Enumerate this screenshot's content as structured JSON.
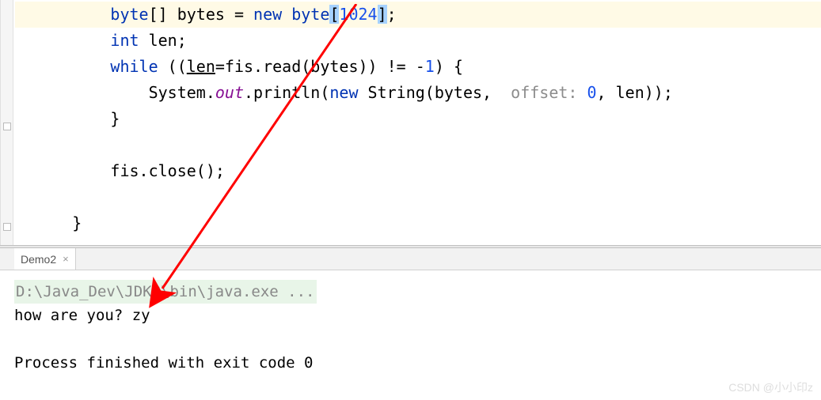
{
  "code": {
    "line1_pre": "          ",
    "line1_kw1": "byte",
    "line1_mid1": "[] bytes = ",
    "line1_kw2": "new byte",
    "line1_br1": "[",
    "line1_num": "1024",
    "line1_br2": "]",
    "line1_end": ";",
    "line2_pre": "          ",
    "line2_kw": "int ",
    "line2_rest": "len;",
    "line3_pre": "          ",
    "line3_kw": "while ",
    "line3_p1": "((",
    "line3_len": "len",
    "line3_mid": "=fis.read(bytes)) != -",
    "line3_num": "1",
    "line3_end": ") {",
    "line4_pre": "              System.",
    "line4_out": "out",
    "line4_mid": ".println(",
    "line4_kw": "new ",
    "line4_str": "String(bytes, ",
    "line4_hint": " offset: ",
    "line4_zero": "0",
    "line4_end": ", len));",
    "line5": "          }",
    "line6": "",
    "line7": "          fis.close();",
    "line8": "",
    "line9": "      }"
  },
  "tab": {
    "name": "Demo2",
    "close": "×"
  },
  "console": {
    "cmd": "D:\\Java_Dev\\JDK8\\bin\\java.exe ...",
    "output": "how are you? zy",
    "exit": "Process finished with exit code 0"
  },
  "watermark": "CSDN @小小印z"
}
